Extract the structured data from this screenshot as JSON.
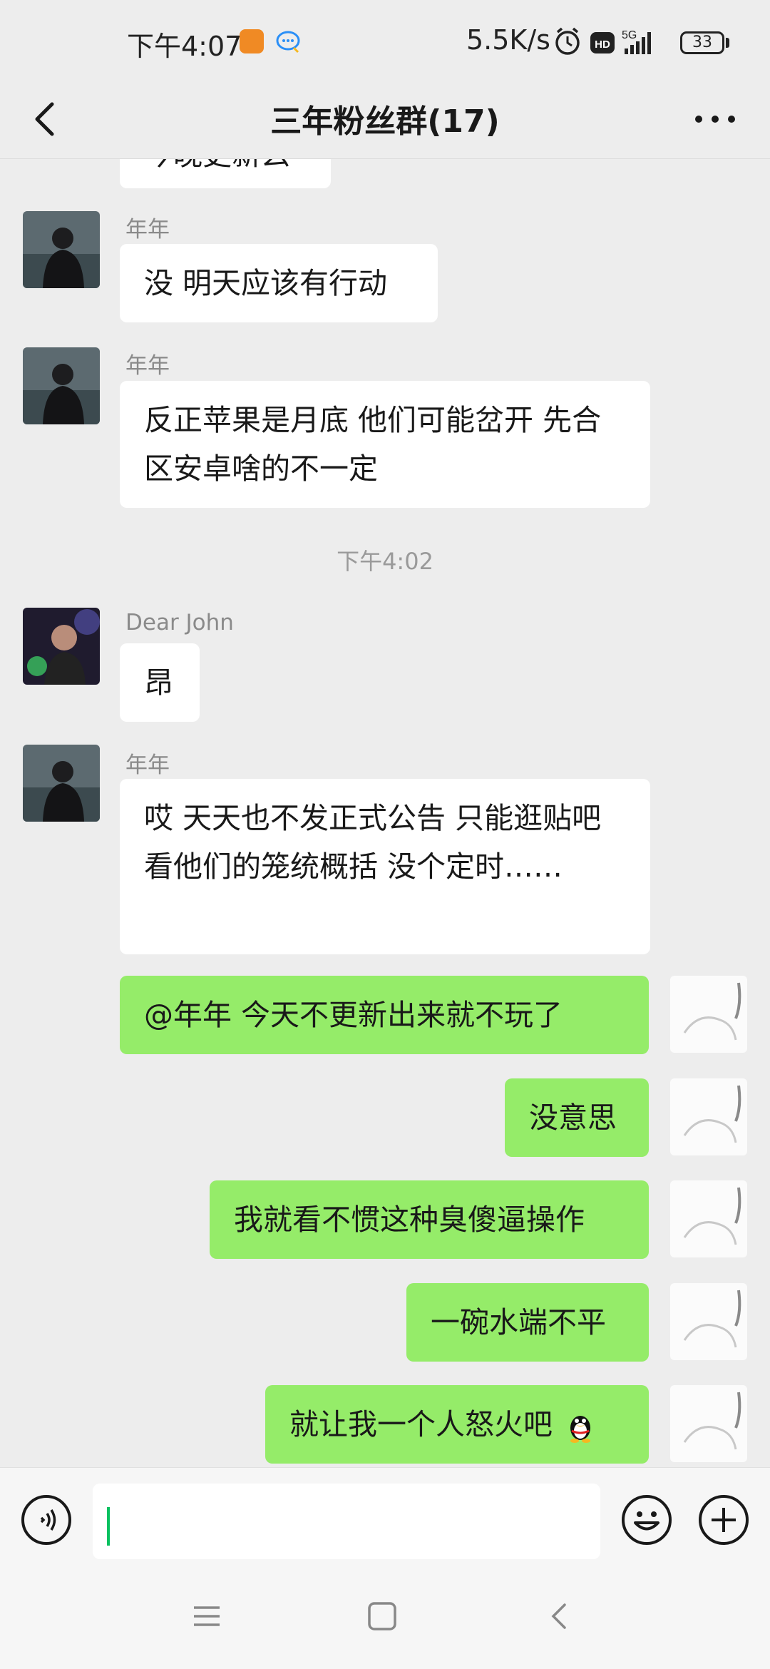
{
  "status_bar": {
    "time": "下午4:07",
    "net_speed": "5.5K/s",
    "network": "5G",
    "hd_badge": "HD",
    "battery": "33"
  },
  "header": {
    "title": "三年粉丝群(17)"
  },
  "chat": {
    "partial_top_text": "今晚更新么",
    "timestamp": "下午4:02",
    "messages": [
      {
        "sender": "年年",
        "text": "没 明天应该有行动"
      },
      {
        "sender": "年年",
        "text": "反正苹果是月底 他们可能岔开 先合区安卓啥的不一定"
      },
      {
        "sender": "Dear John",
        "text": "昂"
      },
      {
        "sender": "年年",
        "text": "哎 天天也不发正式公告 只能逛贴吧看他们的笼统概括 没个定时……"
      },
      {
        "sender": "me",
        "text": "@年年  今天不更新出来就不玩了"
      },
      {
        "sender": "me",
        "text": "没意思"
      },
      {
        "sender": "me",
        "text": "我就看不惯这种臭傻逼操作"
      },
      {
        "sender": "me",
        "text": "一碗水端不平"
      },
      {
        "sender": "me",
        "text": "就让我一个人怒火吧"
      }
    ]
  },
  "input": {
    "value": "",
    "placeholder": ""
  },
  "colors": {
    "background": "#ededed",
    "incoming_bubble": "#ffffff",
    "outgoing_bubble": "#95ec69",
    "caret": "#07c160"
  },
  "icons": {
    "back": "chevron-left-icon",
    "more": "more-dots-icon",
    "voice": "voice-icon",
    "emoji": "emoji-icon",
    "plus": "plus-icon",
    "penguin": "penguin-emoji-icon"
  }
}
